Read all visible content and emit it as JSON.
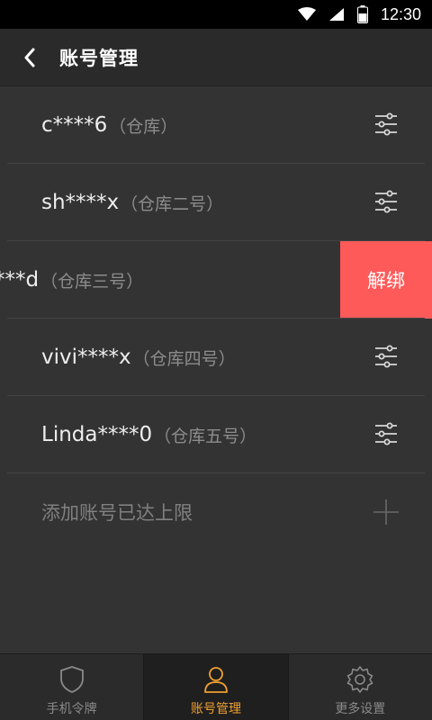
{
  "status_bar": {
    "time": "12:30"
  },
  "header": {
    "title": "账号管理"
  },
  "accounts": [
    {
      "name": "c****6",
      "warehouse": "（仓库）"
    },
    {
      "name": "sh****x",
      "warehouse": "（仓库二号）"
    },
    {
      "name": "***d",
      "warehouse": "（仓库三号）"
    },
    {
      "name": "vivi****x",
      "warehouse": "（仓库四号）"
    },
    {
      "name": "Linda****0",
      "warehouse": "（仓库五号）"
    }
  ],
  "unbind_label": "解绑",
  "add_row": {
    "text": "添加账号已达上限"
  },
  "tabs": [
    {
      "label": "手机令牌"
    },
    {
      "label": "账号管理"
    },
    {
      "label": "更多设置"
    }
  ],
  "colors": {
    "accent": "#f0a030",
    "unbind": "#ff5a5a",
    "background": "#333333"
  }
}
